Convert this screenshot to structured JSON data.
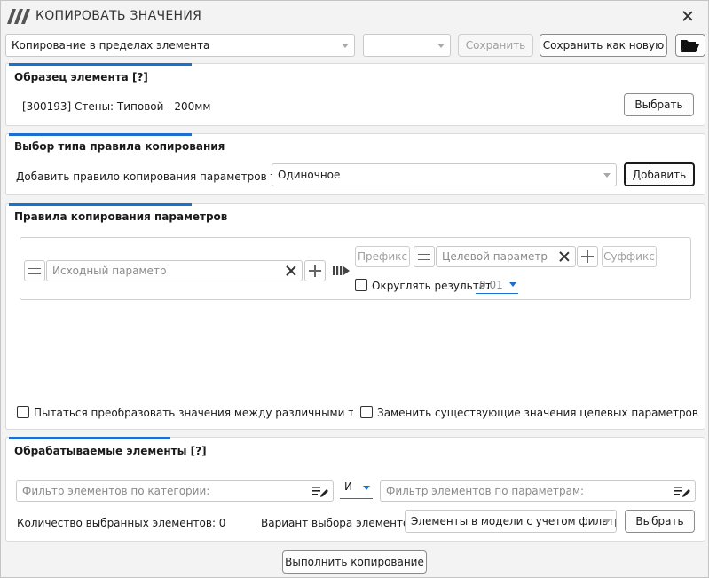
{
  "window": {
    "title": "КОПИРОВАТЬ ЗНАЧЕНИЯ"
  },
  "toolbar": {
    "mode_select": "Копирование в пределах элемента",
    "preset_select": "",
    "save_label": "Сохранить",
    "save_as_new_label": "Сохранить как новую"
  },
  "sample_panel": {
    "title": "Образец элемента [?]",
    "element": "[300193] Стены: Типовой - 200мм",
    "select_label": "Выбрать"
  },
  "rule_type_panel": {
    "title": "Выбор типа правила копирования",
    "add_rule_label": "Добавить правило копирования параметров типа:",
    "rule_type_value": "Одиночное",
    "add_button": "Добавить"
  },
  "rules_panel": {
    "title": "Правила копирования параметров",
    "source_placeholder": "Исходный параметр",
    "prefix_label": "Префикс",
    "target_placeholder": "Целевой параметр",
    "suffix_label": "Суффикс",
    "round_label": "Округлять результат",
    "round_value": "0.01",
    "try_convert_label": "Пытаться преобразовать значения между различными типами п",
    "replace_existing_label": "Заменить существующие значения целевых параметров"
  },
  "elements_panel": {
    "title": "Обрабатываемые элементы [?]",
    "category_filter_placeholder": "Фильтр элементов по категории:",
    "logic_value": "И",
    "param_filter_placeholder": "Фильтр элементов по параметрам:",
    "count_label": "Количество выбранных элементов: 0",
    "variant_label": "Вариант выбора элементов:",
    "variant_value": "Элементы в модели с учетом фильтра",
    "select_label": "Выбрать"
  },
  "footer": {
    "run_label": "Выполнить копирование"
  },
  "colors": {
    "accent": "#1c6fd1",
    "background": "#f3f3f3"
  }
}
